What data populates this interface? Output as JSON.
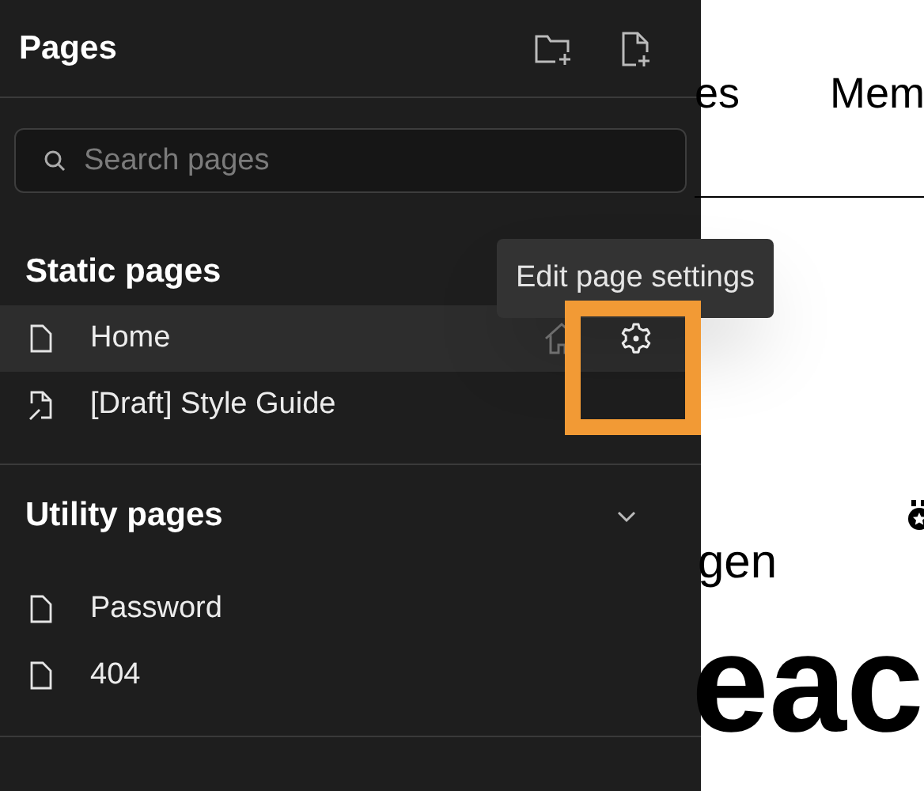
{
  "sidebar": {
    "title": "Pages",
    "search": {
      "placeholder": "Search pages"
    },
    "sections": [
      {
        "title": "Static pages",
        "chevron": false,
        "items": [
          {
            "label": "Home",
            "kind": "page",
            "selected": true
          },
          {
            "label": "[Draft] Style Guide",
            "kind": "draft",
            "selected": false
          }
        ]
      },
      {
        "title": "Utility pages",
        "chevron": true,
        "items": [
          {
            "label": "Password",
            "kind": "page",
            "selected": false
          },
          {
            "label": "404",
            "kind": "page",
            "selected": false
          }
        ]
      }
    ]
  },
  "tooltip": "Edit page settings",
  "canvas": {
    "nav": [
      "es",
      "Mem"
    ],
    "subtitle": "gen",
    "heading": "eac"
  }
}
